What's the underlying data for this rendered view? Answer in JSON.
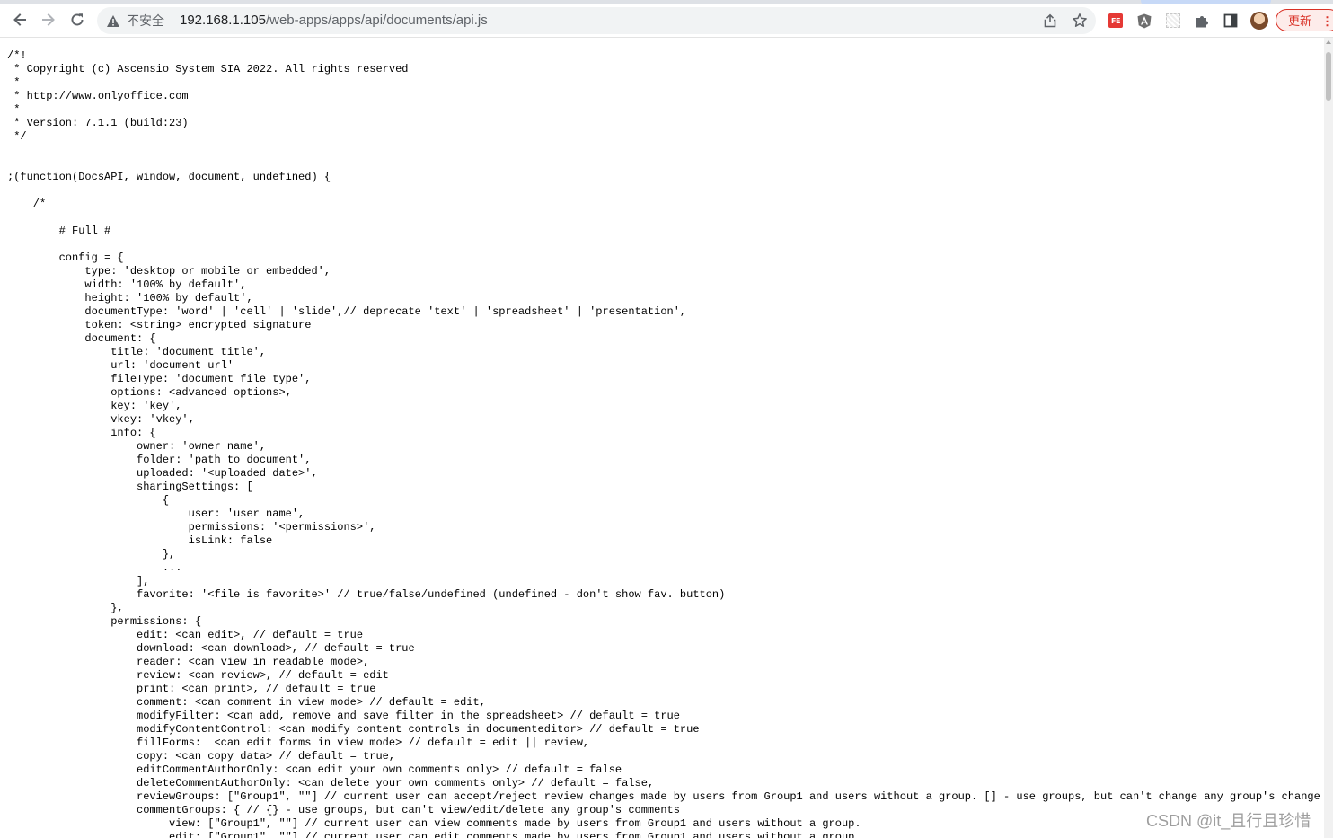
{
  "toolbar": {
    "security_label": "不安全",
    "url_host": "192.168.1.105",
    "url_path": "/web-apps/apps/api/documents/api.js",
    "update_label": "更新",
    "ext_fe_label": "FE"
  },
  "page": {
    "source_text": "/*!\n * Copyright (c) Ascensio System SIA 2022. All rights reserved\n *\n * http://www.onlyoffice.com\n *\n * Version: 7.1.1 (build:23)\n */\n\n\n;(function(DocsAPI, window, document, undefined) {\n\n    /*\n\n        # Full #\n\n        config = {\n            type: 'desktop or mobile or embedded',\n            width: '100% by default',\n            height: '100% by default',\n            documentType: 'word' | 'cell' | 'slide',// deprecate 'text' | 'spreadsheet' | 'presentation',\n            token: <string> encrypted signature\n            document: {\n                title: 'document title',\n                url: 'document url'\n                fileType: 'document file type',\n                options: <advanced options>,\n                key: 'key',\n                vkey: 'vkey',\n                info: {\n                    owner: 'owner name',\n                    folder: 'path to document',\n                    uploaded: '<uploaded date>',\n                    sharingSettings: [\n                        {\n                            user: 'user name',\n                            permissions: '<permissions>',\n                            isLink: false\n                        },\n                        ...\n                    ],\n                    favorite: '<file is favorite>' // true/false/undefined (undefined - don't show fav. button)\n                },\n                permissions: {\n                    edit: <can edit>, // default = true\n                    download: <can download>, // default = true\n                    reader: <can view in readable mode>,\n                    review: <can review>, // default = edit\n                    print: <can print>, // default = true\n                    comment: <can comment in view mode> // default = edit,\n                    modifyFilter: <can add, remove and save filter in the spreadsheet> // default = true\n                    modifyContentControl: <can modify content controls in documenteditor> // default = true\n                    fillForms:  <can edit forms in view mode> // default = edit || review,\n                    copy: <can copy data> // default = true,\n                    editCommentAuthorOnly: <can edit your own comments only> // default = false\n                    deleteCommentAuthorOnly: <can delete your own comments only> // default = false,\n                    reviewGroups: [\"Group1\", \"\"] // current user can accept/reject review changes made by users from Group1 and users without a group. [] - use groups, but can't change any group's changes\n                    commentGroups: { // {} - use groups, but can't view/edit/delete any group's comments\n                         view: [\"Group1\", \"\"] // current user can view comments made by users from Group1 and users without a group.\n                         edit: [\"Group1\", \"\"] // current user can edit comments made by users from Group1 and users without a group."
  },
  "watermark": "CSDN @it_且行且珍惜",
  "colors": {
    "update_accent": "#d93025",
    "fe_badge": "#e53935",
    "text": "#000000"
  },
  "icons": {
    "back": "arrow-left-icon",
    "forward": "arrow-right-icon",
    "reload": "reload-icon",
    "warning": "warning-triangle-icon",
    "share": "share-icon",
    "bookmark": "star-icon",
    "extensions": "puzzle-icon",
    "sidepanel": "side-panel-icon",
    "menu": "more-vert-icon"
  }
}
